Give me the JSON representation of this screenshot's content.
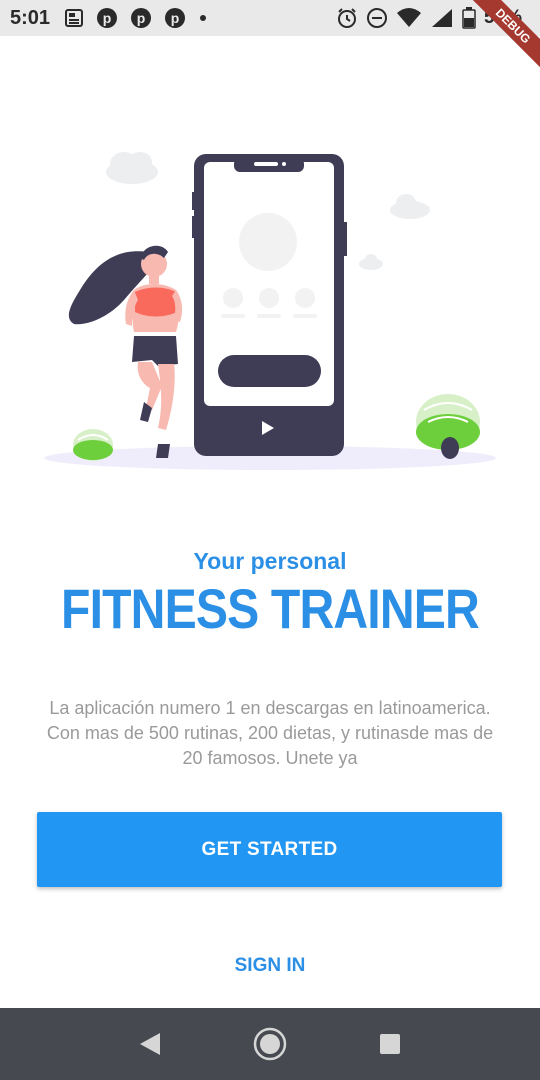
{
  "status_bar": {
    "time": "5:01",
    "battery": "55%",
    "debug_label": "DEBUG",
    "left_icons": [
      "news-icon",
      "pinterest-icon",
      "pinterest-icon",
      "pinterest-icon",
      "dot-icon"
    ],
    "right_icons": [
      "alarm-icon",
      "do-not-disturb-icon",
      "wifi-icon",
      "signal-icon",
      "battery-icon"
    ]
  },
  "onboarding": {
    "subtitle": "Your personal",
    "title": "FITNESS TRAINER",
    "description": "La aplicación numero 1 en descargas en latinoamerica. Con mas de 500 rutinas, 200 dietas, y rutinasde mas de 20 famosos. Unete ya",
    "primary_button": "GET STARTED",
    "secondary_button": "SIGN IN"
  },
  "colors": {
    "accent": "#2196f3",
    "text_accent": "#2b8fe6",
    "nav_bar": "#464a50"
  },
  "nav": {
    "icons": [
      "back-icon",
      "home-icon",
      "recents-icon"
    ]
  }
}
